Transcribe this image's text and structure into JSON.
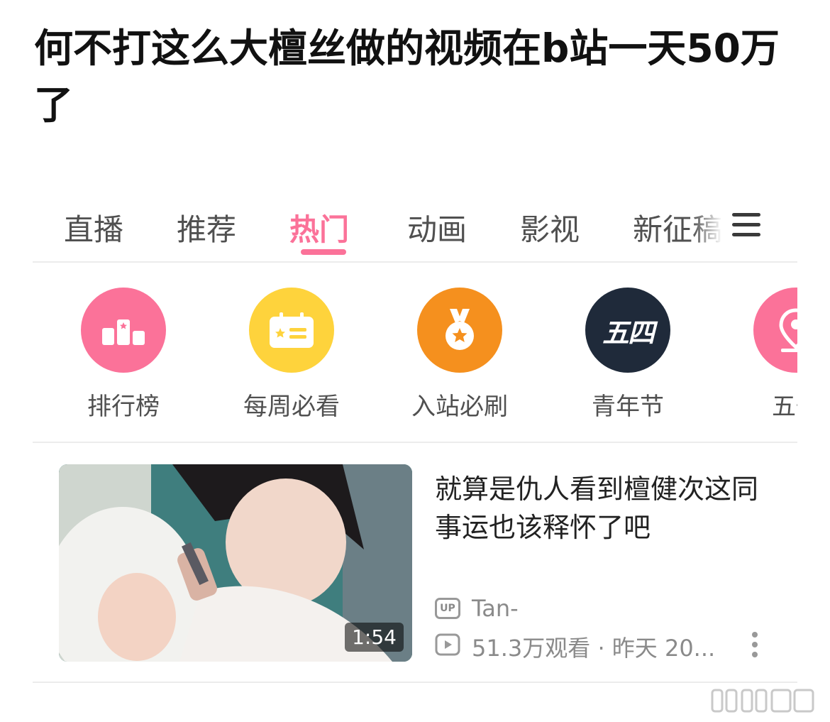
{
  "post": {
    "title": "何不打这么大檀丝做的视频在b站一天50万了"
  },
  "tabs": [
    {
      "label": "直播",
      "active": false
    },
    {
      "label": "推荐",
      "active": false
    },
    {
      "label": "热门",
      "active": true
    },
    {
      "label": "动画",
      "active": false
    },
    {
      "label": "影视",
      "active": false
    },
    {
      "label": "新征稿",
      "active": false
    }
  ],
  "quick_entries": [
    {
      "label": "排行榜",
      "icon": "podium-icon",
      "color": "#fb7299"
    },
    {
      "label": "每周必看",
      "icon": "calendar-card-icon",
      "color": "#fed33c"
    },
    {
      "label": "入站必刷",
      "icon": "medal-icon",
      "color": "#f5901e"
    },
    {
      "label": "青年节",
      "icon": "wusi-badge-icon",
      "color": "#1f2a3a",
      "badge_text": "五四"
    },
    {
      "label": "五一",
      "icon": "map-pin-icon",
      "color": "#fb7299"
    }
  ],
  "video": {
    "title": "就算是仇人看到檀健次这同事运也该释怀了吧",
    "duration": "1:54",
    "uploader": "Tan-",
    "views": "51.3万观看",
    "date": "昨天 20..."
  },
  "colors": {
    "accent": "#fb7299",
    "text_secondary": "#8a8a8a",
    "divider": "#ececec"
  }
}
